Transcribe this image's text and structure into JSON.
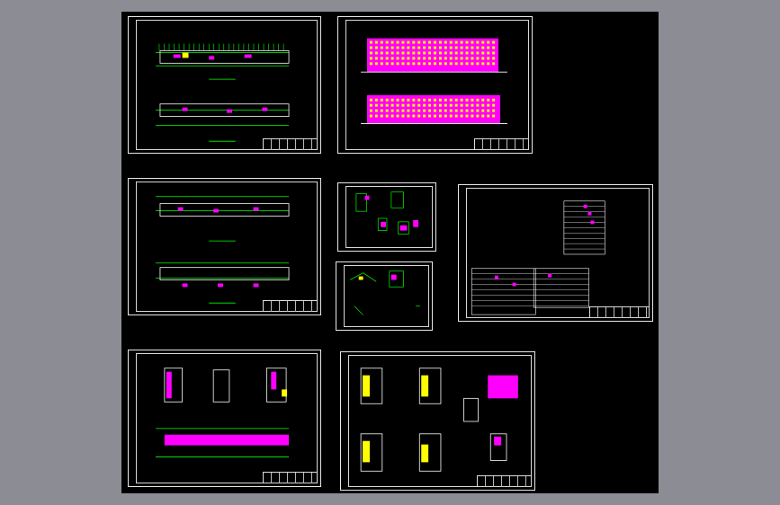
{
  "app": {
    "view": "model-space",
    "background_color": "#8c8c94",
    "canvas_color": "#000000"
  },
  "colors": {
    "green": "#00ff00",
    "magenta": "#ff00ff",
    "white": "#ffffff",
    "yellow": "#ffff00",
    "cyan": "#00ffff",
    "red": "#ff3030"
  },
  "sheets": [
    {
      "id": "sheet-floor-plans-1",
      "kind": "floor-plan"
    },
    {
      "id": "sheet-elevations",
      "kind": "elevation"
    },
    {
      "id": "sheet-floor-plans-2",
      "kind": "floor-plan"
    },
    {
      "id": "sheet-details-1",
      "kind": "detail"
    },
    {
      "id": "sheet-details-2",
      "kind": "detail"
    },
    {
      "id": "sheet-schedule",
      "kind": "table"
    },
    {
      "id": "sheet-sections",
      "kind": "section"
    },
    {
      "id": "sheet-stair-plans",
      "kind": "stair-plan"
    }
  ]
}
